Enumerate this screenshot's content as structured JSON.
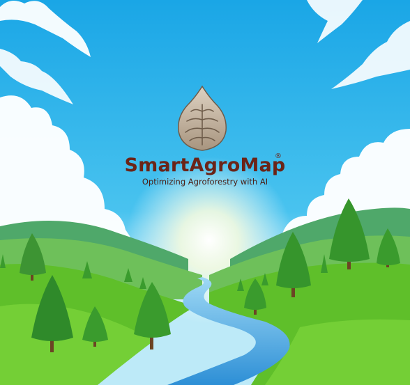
{
  "brand": {
    "name": "SmartAgroMap",
    "registered_mark": "®",
    "tagline": "Optimizing Agroforestry with AI",
    "logo_icon": "tree-leaf-drop-icon"
  },
  "colors": {
    "sky_top": "#1aa6e6",
    "sky_bottom": "#8fdcf6",
    "hill_green": "#5fbf2a",
    "river_blue": "#3ca0e0",
    "brand_text": "#6b2418"
  }
}
